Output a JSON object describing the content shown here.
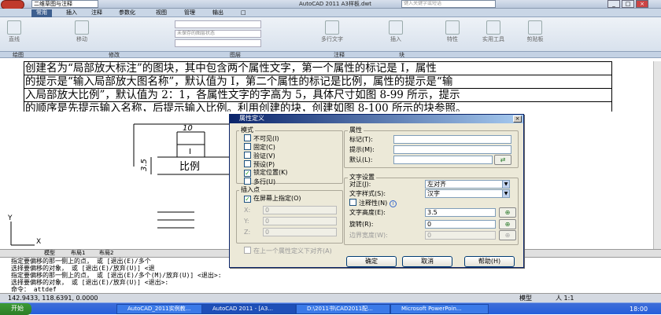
{
  "titlebar": {
    "workspace": "二维草图与注释",
    "app_title": "AutoCAD 2011    A3样板.dwt",
    "search_placeholder": "键入关键字或短语",
    "minimize": "_",
    "restore": "□",
    "close": "×"
  },
  "ribbon_tabs": [
    "常用",
    "插入",
    "注释",
    "参数化",
    "视图",
    "管理",
    "输出",
    "□"
  ],
  "ribbon": {
    "draw_tools": [
      "直线",
      "移动"
    ],
    "layer_state": "未保存的图层状态",
    "annotate_tools": [
      "多行文字"
    ],
    "block_tools": [
      "插入"
    ],
    "other_tools": [
      "特性",
      "实用工具",
      "剪贴板"
    ]
  },
  "panel_labels": [
    "绘图",
    "修改",
    "图层",
    "注释",
    "块"
  ],
  "document_lines": [
    "创建名为“局部放大标注”的图块，其中包含两个属性文字，第一个属性的标记是 I，属性",
    "的提示是“输入局部放大图名称”，默认值为 I，第二个属性的标记是比例，属性的提示是“输",
    "入局部放大比例”，默认值为 2：1，各属性文字的字高为 5，具体尺寸如图 8-99 所示，提示",
    "的顺序是先提示输入名称，后提示输入比例。利用创建的块，创建如图 8-100 所示的块参照。"
  ],
  "drawing": {
    "dim_top": "10",
    "dim_left": "3.5",
    "text_I": "I",
    "text_scale": "比例",
    "ucs_y": "Y",
    "ucs_x": "X"
  },
  "layout_tabs": [
    "模型",
    "布局1",
    "布局2"
  ],
  "command_lines": [
    "指定要偏移的那一侧上的点， 或 [退出(E)/多个",
    "选择要偏移的对象， 或 [退出(E)/放弃(U)] <退",
    "指定要偏移的那一侧上的点， 或 [退出(E)/多个(M)/放弃(U)] <退出>:",
    "选择要偏移的对象， 或 [退出(E)/放弃(U)] <退出>:",
    "命令： attdef"
  ],
  "statusbar": {
    "coords": "142.9433, 118.6391, 0.0000",
    "model": "模型",
    "scale": "人 1:1"
  },
  "dialog": {
    "title": "属性定义",
    "close": "×",
    "mode_label": "模式",
    "modes": [
      {
        "label": "不可见(I)",
        "checked": false
      },
      {
        "label": "固定(C)",
        "checked": false
      },
      {
        "label": "验证(V)",
        "checked": false
      },
      {
        "label": "预设(P)",
        "checked": false
      },
      {
        "label": "锁定位置(K)",
        "checked": true
      },
      {
        "label": "多行(U)",
        "checked": false
      }
    ],
    "attr_label": "属性",
    "tag_label": "标记(T):",
    "tag_value": "",
    "prompt_label": "提示(M):",
    "prompt_value": "",
    "default_label": "默认(L):",
    "default_value": "",
    "insert_label": "插入点",
    "onscreen_label": "在屏幕上指定(O)",
    "onscreen_checked": true,
    "x_label": "X:",
    "x_value": "0",
    "y_label": "Y:",
    "y_value": "0",
    "z_label": "Z:",
    "z_value": "0",
    "text_label": "文字设置",
    "justify_label": "对正(J):",
    "justify_value": "左对齐",
    "style_label": "文字样式(S):",
    "style_value": "汉字",
    "annotative_label": "注释性(N)",
    "height_label": "文字高度(E):",
    "height_value": "3.5",
    "rotation_label": "旋转(R):",
    "rotation_value": "0",
    "boundary_label": "边界宽度(W):",
    "boundary_value": "0",
    "align_below_label": "在上一个属性定义下对齐(A)",
    "ok": "确定",
    "cancel": "取消",
    "help": "帮助(H)"
  },
  "taskbar": {
    "start": "开始",
    "tasks": [
      "AutoCAD_2011实例教...",
      "AutoCAD 2011 - [A3...",
      "D:\\2011书\\CAD2011配...",
      "Microsoft PowerPoin..."
    ],
    "clock": "18:00"
  }
}
